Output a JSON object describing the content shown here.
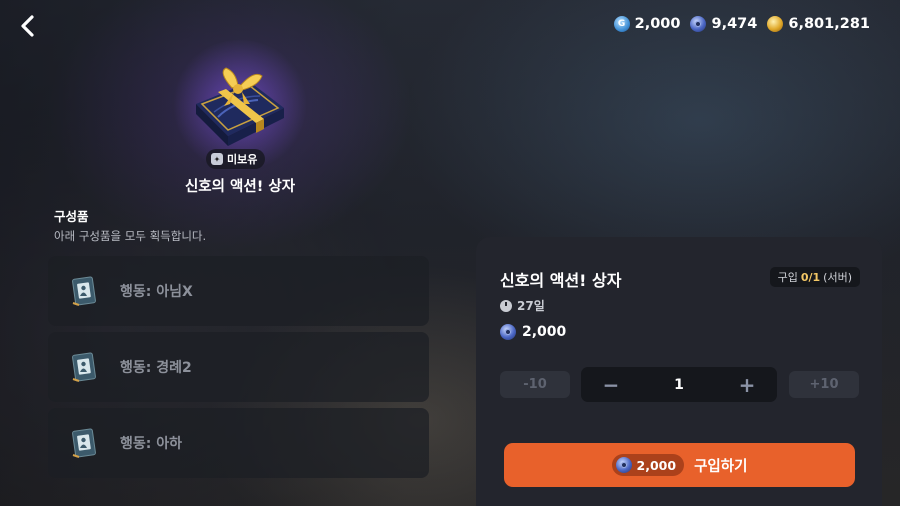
{
  "header": {
    "back_icon": "chevron-left-icon",
    "currencies": [
      {
        "icon": "g-coin-icon",
        "value": "2,000"
      },
      {
        "icon": "blue-gem-icon",
        "value": "9,474"
      },
      {
        "icon": "gold-coin-icon",
        "value": "6,801,281"
      }
    ]
  },
  "item": {
    "image_icon": "gift-box-icon",
    "owned_status": "미보유",
    "title": "신호의 액션! 상자"
  },
  "components": {
    "label": "구성품",
    "description": "아래 구성품을 모두 획득합니다.",
    "items": [
      {
        "icon": "action-book-icon",
        "label": "행동: 아님X"
      },
      {
        "icon": "action-book-icon",
        "label": "행동: 경례2"
      },
      {
        "icon": "action-book-icon",
        "label": "행동: 아하"
      }
    ]
  },
  "purchase": {
    "title": "신호의 액션! 상자",
    "limit_prefix": "구입",
    "limit_value": "0/1",
    "limit_suffix": "(서버)",
    "duration": "27일",
    "price": "2,000",
    "minus10": "-10",
    "minus": "−",
    "quantity": "1",
    "plus": "+",
    "plus10": "+10",
    "buy_price": "2,000",
    "buy_label": "구입하기"
  },
  "colors": {
    "buy_button": "#e8612b",
    "panel": "#23252d",
    "limit_highlight": "#f3c766"
  }
}
